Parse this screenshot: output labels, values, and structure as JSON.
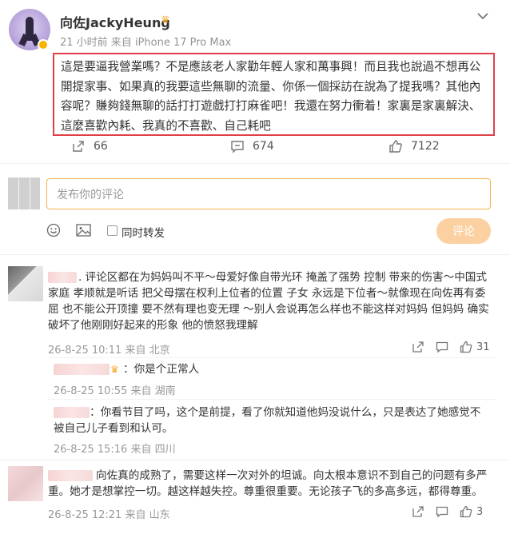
{
  "post": {
    "username": "向佐JackyHeung",
    "crown_glyph": "♛",
    "meta": "21 小时前  来自 iPhone 17 Pro Max",
    "text": "這是要逼我營業嗎？不是應該老人家勸年輕人家和萬事興！而且我也說過不想再公開提家事、如果真的我要這些無聊的流量、你係一個採訪在說為了提我嗎？其他內容呢？賺夠錢無聊的話打打遊戲打打麻雀吧！我還在努力衝着！家裏是家裏解決、這麼喜歡內耗、我真的不喜歡、自己耗吧",
    "repost_count": "66",
    "comment_count": "674",
    "like_count": "7122"
  },
  "composer": {
    "placeholder": "发布你的评论",
    "repost_label": "同时转发",
    "submit_label": "评论"
  },
  "comments": [
    {
      "text": ". 评论区都在为妈妈叫不平～母爱好像自带光环 掩盖了强势 控制 带来的伤害～中国式家庭 孝顺就是听话 把父母摆在权利上位者的位置 子女 永远是下位者～就像现在向佐再有委屈 也不能公开顶撞 要不然有理也变无理 ～别人会说再怎么样也不能这样对妈妈 但妈妈 确实破坏了他刚刚好起来的形象 他的愤怒我理解",
      "meta": "26-8-25 10:11  来自 北京",
      "likes": "31"
    },
    {
      "text": "向佐真的成熟了，需要这样一次对外的坦诚。向太根本意识不到自己的问题有多严重。她才是想掌控一切。越这样越失控。尊重很重要。无论孩子飞的多高多远，都得尊重。",
      "meta": "26-8-25 12:21  来自 山东",
      "likes": "3"
    }
  ],
  "replies": [
    {
      "text": "：你是个正常人",
      "meta": "26-8-25 10:55  来自 湖南"
    },
    {
      "text": "：你看节目了吗，这个是前提，看了你就知道他妈没说什么，只是表达了她感觉不被自己儿子看到和认可。",
      "meta": "26-8-25 15:16  来自 四川"
    }
  ],
  "colors": {
    "highlight_border": "#e0404a",
    "accent": "#f6b24a",
    "submit_bg": "#fbd1a1",
    "blur": "#f7d3d3"
  }
}
